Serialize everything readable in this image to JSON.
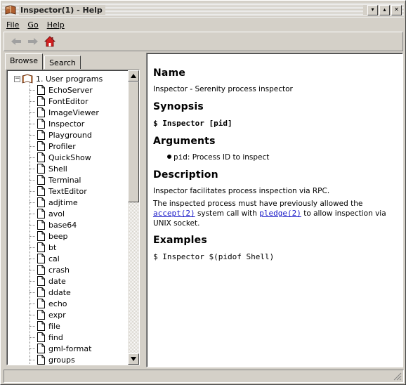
{
  "window": {
    "title": "Inspector(1) - Help",
    "title_icon": "book-icon",
    "buttons": [
      "minimize",
      "maximize",
      "close"
    ],
    "min_glyph": "▾",
    "max_glyph": "▴",
    "close_glyph": "✕"
  },
  "menubar": {
    "file": "File",
    "go": "Go",
    "help": "Help"
  },
  "toolbar": {
    "back_icon": "arrow-left-icon",
    "forward_icon": "arrow-right-icon",
    "home_icon": "home-icon"
  },
  "tabs": {
    "browse": "Browse",
    "search": "Search"
  },
  "tree": {
    "root": "1. User programs",
    "items": [
      "EchoServer",
      "FontEditor",
      "ImageViewer",
      "Inspector",
      "Playground",
      "Profiler",
      "QuickShow",
      "Shell",
      "Terminal",
      "TextEditor",
      "adjtime",
      "avol",
      "base64",
      "beep",
      "bt",
      "cal",
      "crash",
      "date",
      "ddate",
      "echo",
      "expr",
      "file",
      "find",
      "gml-format",
      "groups"
    ]
  },
  "doc": {
    "name_heading": "Name",
    "name_text": "Inspector - Serenity process inspector",
    "synopsis_heading": "Synopsis",
    "synopsis_code": "$ Inspector [pid]",
    "arguments_heading": "Arguments",
    "arg_name": "pid",
    "arg_desc": ": Process ID to inspect",
    "description_heading": "Description",
    "desc_line1": "Inspector facilitates process inspection via RPC.",
    "desc_p2_a": "The inspected process must have previously allowed the ",
    "desc_link1": "accept(2)",
    "desc_p2_b": " system call with ",
    "desc_link2": "pledge(2)",
    "desc_p2_c": " to allow inspection via UNIX socket.",
    "examples_heading": "Examples",
    "example_code": "$ Inspector $(pidof Shell)"
  },
  "colors": {
    "chrome": "#d4d0c8",
    "link": "#1a1ac8"
  }
}
